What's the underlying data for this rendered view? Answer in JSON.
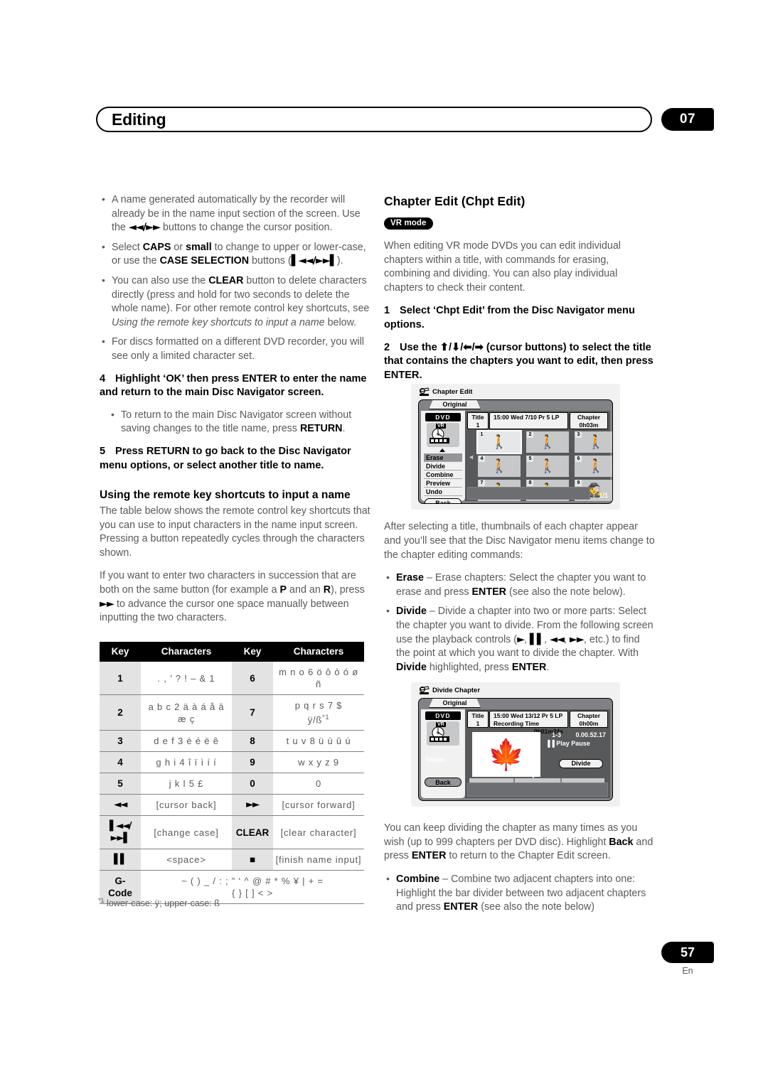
{
  "header": {
    "title": "Editing",
    "chapter_badge": "07"
  },
  "footer": {
    "page_number": "57",
    "language_code": "En"
  },
  "left_column": {
    "bullets_top": [
      "A name generated automatically by the recorder will already be in the name input section of the screen. Use the ◄◄/►► buttons to change the cursor position.",
      "Select CAPS or small to change to upper or lower-case, or use the CASE SELECTION buttons (▎◄◄/►►▎).",
      "You can also use the CLEAR button to delete characters directly (press and hold for two seconds to delete the whole name). For other remote control key shortcuts, see Using the remote key shortcuts to input a name below.",
      "For discs formatted on a different DVD recorder, you will see only a limited character set."
    ],
    "step4_num": "4",
    "step4_text": "Highlight ‘OK’ then press ENTER to enter the name and return to the main Disc Navigator screen.",
    "step4_bullet": "To return to the main Disc Navigator screen without saving changes to the title name, press RETURN.",
    "step5_num": "5",
    "step5_text": "Press RETURN to go back to the Disc Navigator menu options, or select another title to name.",
    "sub_heading": "Using the remote key shortcuts to input a name",
    "para1": "The table below shows the remote control key shortcuts that you can use to input characters in the name input screen. Pressing a button repeatedly cycles through the characters shown.",
    "para2": "If you want to enter two characters in succession that are both on the same button (for example a P and an R), press ►► to advance the cursor one space manually between inputting the two characters."
  },
  "key_table": {
    "headers": [
      "Key",
      "Characters",
      "Key",
      "Characters"
    ],
    "rows": [
      {
        "key_a": "1",
        "chars_a": ". , ’ ? ! – & 1",
        "key_b": "6",
        "chars_b": "m n o 6 ö ô ò ó ø ñ"
      },
      {
        "key_a": "2",
        "chars_a": "a b c 2 ä à á å ā\næ ç",
        "key_b": "7",
        "chars_b": "p q r s 7 $\nÿ/ß *1"
      },
      {
        "key_a": "3",
        "chars_a": "d e f 3 è é ë ê",
        "key_b": "8",
        "chars_b": "t u v 8 ü ù û ú"
      },
      {
        "key_a": "4",
        "chars_a": "g h i 4 î ï ì í í",
        "key_b": "9",
        "chars_b": "w x y z 9"
      },
      {
        "key_a": "5",
        "chars_a": "j k l 5 £",
        "key_b": "0",
        "chars_b": "0"
      },
      {
        "key_a": "◄◄",
        "chars_a": "[cursor back]",
        "key_b": "►►",
        "chars_b": "[cursor forward]"
      },
      {
        "key_a": "▎◄◄/\n►►▎",
        "chars_a": "[change case]",
        "key_b": "CLEAR",
        "chars_b": "[clear character]"
      },
      {
        "key_a": "▐▐",
        "chars_a": "<space>",
        "key_b": "■",
        "chars_b": "[finish name input]"
      }
    ],
    "gcode_key": "G-\nCode",
    "gcode_chars": "~ ( ) _ / : ; ” ‘ ^ @ # * % ¥ | + =\n{ } [ ] < >",
    "footnote": "*1 lower-case: ÿ; upper-case: ß"
  },
  "right_column": {
    "section_heading": "Chapter Edit (Chpt Edit)",
    "mode_badge": "VR mode",
    "intro": "When editing VR mode DVDs you can edit individual chapters within a title, with commands for erasing, combining and dividing. You can also play individual chapters to check their content.",
    "step1_num": "1",
    "step1_text": "Select ‘Chpt Edit’ from the Disc Navigator menu options.",
    "step2_num": "2",
    "step2_text": "Use the ⬆/⬇/⬅/➡ (cursor buttons) to select the title that contains the chapters you want to edit, then press ENTER.",
    "after_select": "After selecting a title, thumbnails of each chapter appear and you’ll see that the Disc Navigator menu items change to the chapter editing commands:",
    "erase_label": "Erase",
    "erase_text": " – Erase chapters: Select the chapter you want to erase and press ENTER (see also the note below).",
    "divide_label": "Divide",
    "divide_text": " – Divide a chapter into two or more parts: Select the chapter you want to divide. From the following screen use the playback controls (►, ▐▐, ◄◄, ►►, etc.) to find the point at which you want to divide the chapter. With Divide highlighted, press ENTER.",
    "keep_dividing": "You can keep dividing the chapter as many times as you wish (up to 999 chapters per DVD disc). Highlight Back and press ENTER to return to the Chapter Edit screen.",
    "combine_label": "Combine",
    "combine_text": " – Combine two adjacent chapters into one: Highlight the bar divider between two adjacent chapters and press ENTER (see also the note below)"
  },
  "screenshot_chapter_edit": {
    "title": "Chapter Edit",
    "tab": "Original",
    "disc_logo": "DVD",
    "disc_mode": "VR",
    "title_label": "Title",
    "title_value": "1",
    "info_text": "15:00 Wed  7/10 Pr 5   LP",
    "chapter_label": "Chapter",
    "chapter_time": "0h03m",
    "menu_items": [
      "Erase",
      "Divide",
      "Combine",
      "Preview",
      "Undo"
    ],
    "selected_menu": "Erase",
    "back_label": "Back",
    "thumbnails": [
      "1",
      "2",
      "3",
      "4",
      "5",
      "6",
      "7",
      "8",
      "9"
    ],
    "selected_thumbnail": "1",
    "page_indicator": "1/1"
  },
  "screenshot_divide_chapter": {
    "title": "Divide Chapter",
    "tab": "Original",
    "disc_logo": "DVD",
    "disc_mode": "VR",
    "title_label": "Title",
    "title_value": "1",
    "info_line1": "15:00 Wed  13/12   Pr 5     LP",
    "info_line2": "Recording Time",
    "recording_time": "0h01m24s",
    "chapter_label": "Chapter",
    "chapter_time": "0h00m",
    "chapter_range": "1-3",
    "timecode": "0.00.52.17",
    "play_state": "▐▐ Play Pause",
    "menu_item": "Divide",
    "back_label": "Back",
    "divide_button": "Divide"
  }
}
